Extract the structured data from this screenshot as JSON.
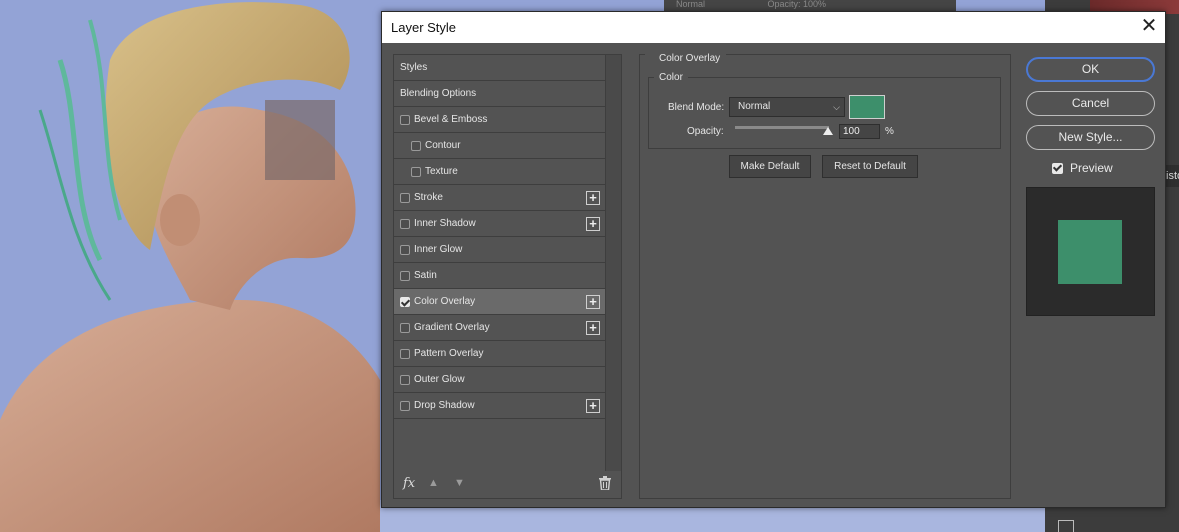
{
  "dialog": {
    "title": "Layer Style",
    "close_icon": "close-icon"
  },
  "styles_list": {
    "items": [
      {
        "label": "Styles",
        "has_checkbox": false,
        "checked": false,
        "indent": false,
        "has_plus": false,
        "selected": false
      },
      {
        "label": "Blending Options",
        "has_checkbox": false,
        "checked": false,
        "indent": false,
        "has_plus": false,
        "selected": false
      },
      {
        "label": "Bevel & Emboss",
        "has_checkbox": true,
        "checked": false,
        "indent": false,
        "has_plus": false,
        "selected": false
      },
      {
        "label": "Contour",
        "has_checkbox": true,
        "checked": false,
        "indent": true,
        "has_plus": false,
        "selected": false
      },
      {
        "label": "Texture",
        "has_checkbox": true,
        "checked": false,
        "indent": true,
        "has_plus": false,
        "selected": false
      },
      {
        "label": "Stroke",
        "has_checkbox": true,
        "checked": false,
        "indent": false,
        "has_plus": true,
        "selected": false
      },
      {
        "label": "Inner Shadow",
        "has_checkbox": true,
        "checked": false,
        "indent": false,
        "has_plus": true,
        "selected": false
      },
      {
        "label": "Inner Glow",
        "has_checkbox": true,
        "checked": false,
        "indent": false,
        "has_plus": false,
        "selected": false
      },
      {
        "label": "Satin",
        "has_checkbox": true,
        "checked": false,
        "indent": false,
        "has_plus": false,
        "selected": false
      },
      {
        "label": "Color Overlay",
        "has_checkbox": true,
        "checked": true,
        "indent": false,
        "has_plus": true,
        "selected": true
      },
      {
        "label": "Gradient Overlay",
        "has_checkbox": true,
        "checked": false,
        "indent": false,
        "has_plus": true,
        "selected": false
      },
      {
        "label": "Pattern Overlay",
        "has_checkbox": true,
        "checked": false,
        "indent": false,
        "has_plus": false,
        "selected": false
      },
      {
        "label": "Outer Glow",
        "has_checkbox": true,
        "checked": false,
        "indent": false,
        "has_plus": false,
        "selected": false
      },
      {
        "label": "Drop Shadow",
        "has_checkbox": true,
        "checked": false,
        "indent": false,
        "has_plus": true,
        "selected": false
      }
    ],
    "toolbar": {
      "fx_label": "fx",
      "icons": [
        "fx-icon",
        "arrow-up-icon",
        "arrow-down-icon",
        "trash-icon"
      ]
    }
  },
  "color_overlay": {
    "section_title": "Color Overlay",
    "group_title": "Color",
    "blend_mode_label": "Blend Mode:",
    "blend_mode_value": "Normal",
    "swatch_color": "#3d8f6b",
    "opacity_label": "Opacity:",
    "opacity_value": "100",
    "opacity_unit": "%",
    "opacity_level": 100,
    "make_default_label": "Make Default",
    "reset_default_label": "Reset to Default"
  },
  "actions": {
    "ok_label": "OK",
    "cancel_label": "Cancel",
    "new_style_label": "New Style...",
    "preview_label": "Preview",
    "preview_checked": true
  },
  "background_app": {
    "top_strip_left": "Normal",
    "top_strip_right": "Opacity: 100%",
    "side_tab_text": "isto"
  },
  "colors": {
    "dialog_bg": "#535353",
    "selected_row": "#6a6a6a",
    "ok_focus": "#4a78d4",
    "preview_bg": "#2b2b2b"
  }
}
